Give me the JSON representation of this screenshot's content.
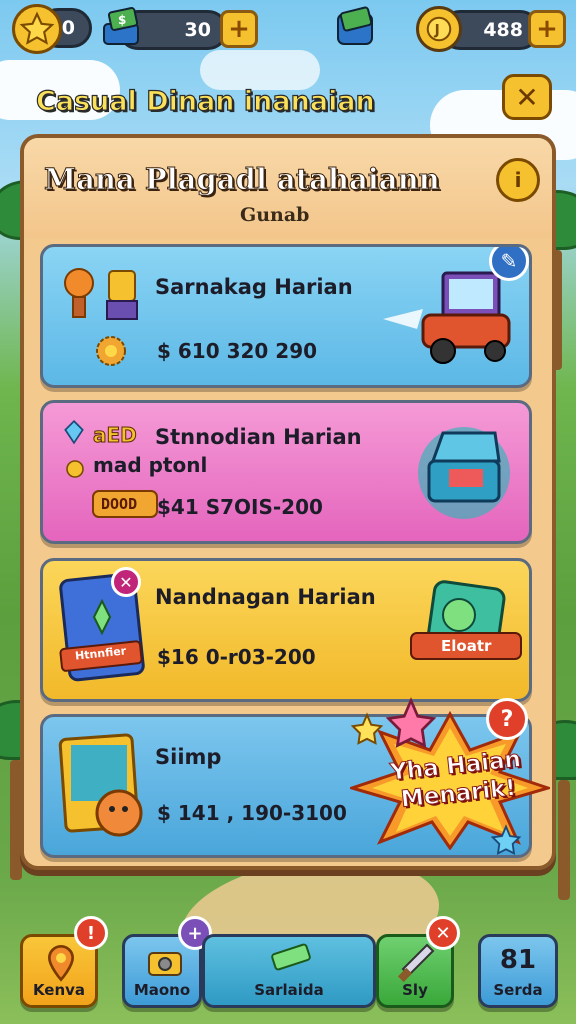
{
  "hud": {
    "star_count": "0",
    "cash_value": "30",
    "gem_icon": "money-stack-icon",
    "coin_value": "488",
    "plus_label": "+"
  },
  "header": {
    "game_title": "Casual Dinan inanaian",
    "close_symbol": "✕"
  },
  "panel": {
    "title": "Mana Plagadl atahaiann",
    "subtitle": "Gunab",
    "info_symbol": "i"
  },
  "cards": [
    {
      "title": "Sarnakag Harian",
      "price": "$ 610 320 290",
      "color": "#6fc6ee"
    },
    {
      "title": "Stnnodian Harian",
      "tag": "aED",
      "subtext": "mad ptonl",
      "coupon": "DOOD",
      "price": "$41  S7OIS-200",
      "color": "#ef7ac8"
    },
    {
      "title": "Nandnagan Harian",
      "card_label": "Htnnfier",
      "price": "$16 0-r03-200",
      "stamp": "Eloatr",
      "color": "#f7c73c"
    },
    {
      "title": "Siimp",
      "price": "$ 141 , 190-3100",
      "color": "#5fb6e6"
    }
  ],
  "promo": {
    "text_line1": "Yha Haian",
    "text_line2": "Menarik!",
    "badge_symbol": "?"
  },
  "nav": [
    {
      "label": "Kenva"
    },
    {
      "label": "Maono"
    },
    {
      "label": "Sarlaida"
    },
    {
      "label": "Sly"
    },
    {
      "label": "Serda",
      "count": "81"
    }
  ],
  "colors": {
    "panel_bg": "#f4c98e",
    "accent_gold": "#f5c12f",
    "title_yellow": "#fbe15a"
  }
}
